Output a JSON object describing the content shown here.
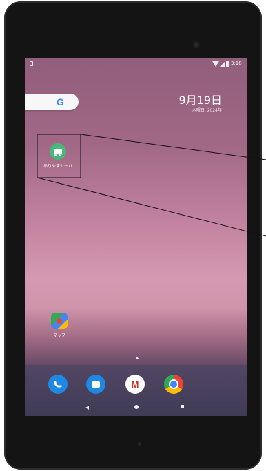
{
  "status_bar": {
    "time": "3:18"
  },
  "search_bar": {
    "logo": "G"
  },
  "clock_widget": {
    "date": "9月19日",
    "subdate": "木曜日, 2024年"
  },
  "home_apps": [
    {
      "label": "ありやすセーバ"
    },
    {
      "label": "マップ"
    }
  ],
  "dock": {
    "apps": [
      "phone-icon",
      "messages-icon",
      "gmail-icon",
      "chrome-icon"
    ],
    "gmail_letter": "M"
  },
  "colors": {
    "wallpaper_top": "#915e7b",
    "wallpaper_mid": "#d59ab1",
    "wallpaper_bottom": "#3a3148",
    "device_frame": "#141414"
  }
}
